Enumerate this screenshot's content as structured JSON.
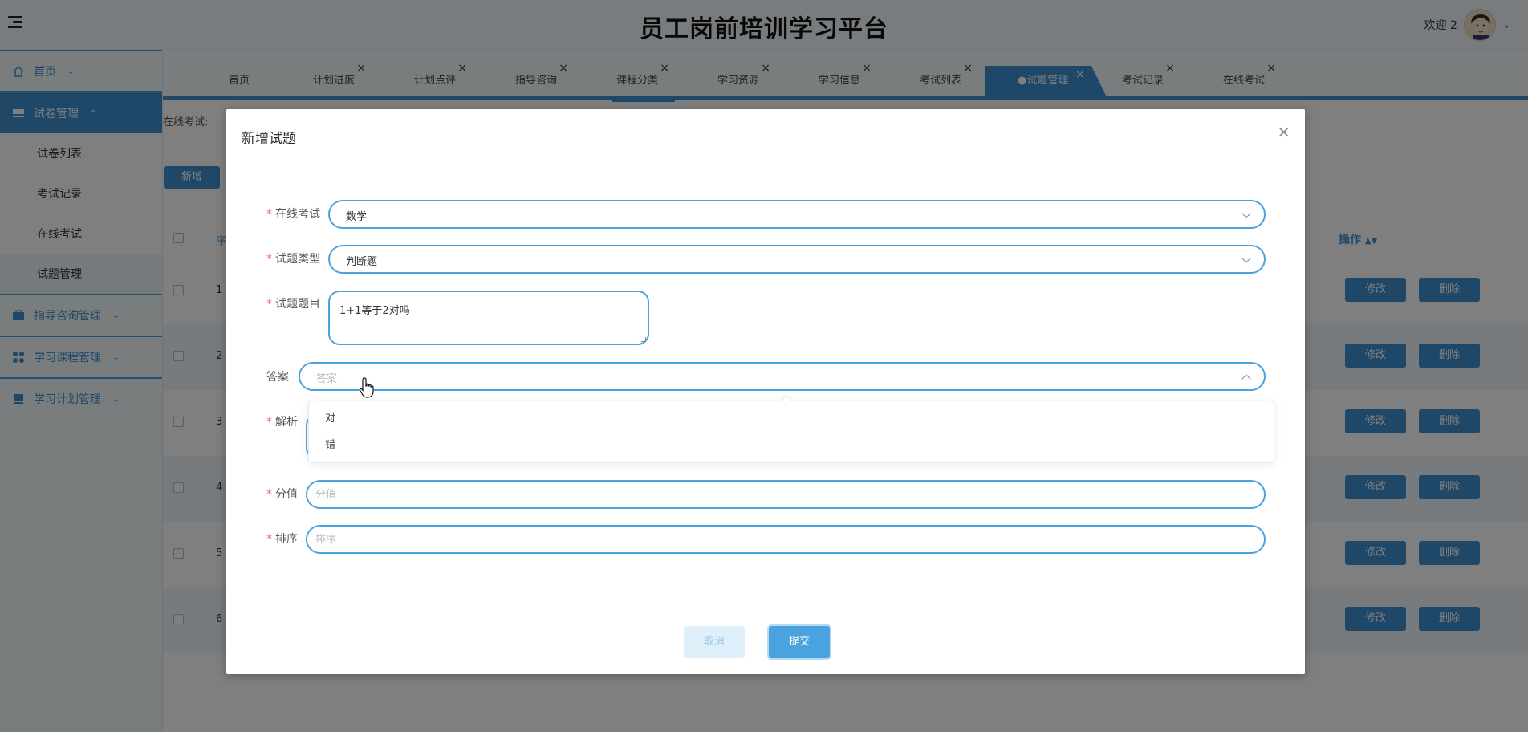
{
  "header": {
    "title": "员工岗前培训学习平台",
    "welcome": "欢迎 2"
  },
  "sidebar": {
    "items": [
      {
        "label": "首页"
      },
      {
        "label": "试卷管理"
      },
      {
        "label": "指导咨询管理"
      },
      {
        "label": "学习课程管理"
      },
      {
        "label": "学习计划管理"
      }
    ],
    "sub_items": [
      {
        "label": "试卷列表"
      },
      {
        "label": "考试记录"
      },
      {
        "label": "在线考试"
      },
      {
        "label": "试题管理"
      }
    ]
  },
  "tabs": [
    {
      "label": "首页"
    },
    {
      "label": "计划进度"
    },
    {
      "label": "计划点评"
    },
    {
      "label": "指导咨询"
    },
    {
      "label": "课程分类"
    },
    {
      "label": "学习资源"
    },
    {
      "label": "学习信息"
    },
    {
      "label": "考试列表"
    },
    {
      "label": "●试题管理"
    },
    {
      "label": "考试记录"
    },
    {
      "label": "在线考试"
    }
  ],
  "tab_close": "×",
  "background": {
    "filter_label": "在线考试:",
    "add_button": "新增",
    "op_header": "操作",
    "index_header": "序",
    "rows": [
      {
        "index": "1"
      },
      {
        "index": "2"
      },
      {
        "index": "3"
      },
      {
        "index": "4"
      },
      {
        "index": "5"
      },
      {
        "index": "6"
      }
    ],
    "edit_label": "修改",
    "delete_label": "删除"
  },
  "dialog": {
    "title": "新增试题",
    "close": "×",
    "fields": {
      "exam": {
        "label": "在线考试",
        "value": "数学"
      },
      "type": {
        "label": "试题类型",
        "value": "判断题"
      },
      "question": {
        "label": "试题题目",
        "value": "1+1等于2对吗"
      },
      "answer": {
        "label": "答案",
        "placeholder": "答案"
      },
      "analysis": {
        "label": "解析"
      },
      "score": {
        "label": "分值",
        "placeholder": "分值"
      },
      "order": {
        "label": "排序",
        "placeholder": "排序"
      }
    },
    "answer_options": [
      "对",
      "错"
    ],
    "cancel": "取消",
    "submit": "提交"
  },
  "colors": {
    "primary": "#3d8fd0",
    "border": "#4aa3df",
    "required": "#f56c6c"
  },
  "icons": {
    "menu": "hamburger-icon",
    "home": "home-icon",
    "exam": "folder-icon",
    "guidance": "briefcase-icon",
    "course": "grid-icon",
    "plan": "book-icon"
  }
}
